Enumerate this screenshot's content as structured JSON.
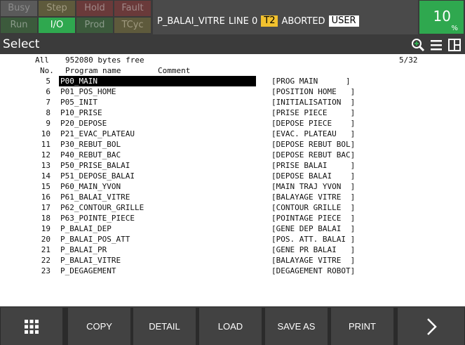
{
  "status_indicators": [
    {
      "label": "Busy"
    },
    {
      "label": "Step"
    },
    {
      "label": "Hold"
    },
    {
      "label": "Fault"
    },
    {
      "label": "Run"
    },
    {
      "label": "I/O"
    },
    {
      "label": "Prod"
    },
    {
      "label": "TCyc"
    }
  ],
  "title_bar": {
    "program": "P_BALAI_VITRE",
    "line": "LINE 0",
    "task_badge": "T2",
    "state": "ABORTED",
    "user_badge": "USER"
  },
  "override": {
    "value": "10",
    "unit": "%"
  },
  "header": {
    "title": "Select"
  },
  "icons": {
    "zoom": "zoom-in-icon",
    "menu": "hamburger-menu-icon",
    "split": "split-window-icon"
  },
  "list_info": {
    "filter": "All",
    "memory": "952080 bytes free",
    "page": "5/32",
    "col_no": "No.",
    "col_name": "Program name",
    "col_comment": "Comment"
  },
  "programs": [
    {
      "no": "5",
      "name": "P00_MAIN",
      "comment": "[PROG MAIN      ]",
      "selected": true
    },
    {
      "no": "6",
      "name": "P01_POS_HOME",
      "comment": "[POSITION HOME   ]"
    },
    {
      "no": "7",
      "name": "P05_INIT",
      "comment": "[INITIALISATION  ]"
    },
    {
      "no": "8",
      "name": "P10_PRISE",
      "comment": "[PRISE PIECE     ]"
    },
    {
      "no": "9",
      "name": "P20_DEPOSE",
      "comment": "[DEPOSE PIECE    ]"
    },
    {
      "no": "10",
      "name": "P21_EVAC_PLATEAU",
      "comment": "[EVAC. PLATEAU   ]"
    },
    {
      "no": "11",
      "name": "P30_REBUT_BOL",
      "comment": "[DEPOSE REBUT BOL]"
    },
    {
      "no": "12",
      "name": "P40_REBUT_BAC",
      "comment": "[DEPOSE REBUT BAC]"
    },
    {
      "no": "13",
      "name": "P50_PRISE_BALAI",
      "comment": "[PRISE BALAI     ]"
    },
    {
      "no": "14",
      "name": "P51_DEPOSE_BALAI",
      "comment": "[DEPOSE BALAI    ]"
    },
    {
      "no": "15",
      "name": "P60_MAIN_YVON",
      "comment": "[MAIN TRAJ YVON  ]"
    },
    {
      "no": "16",
      "name": "P61_BALAI_VITRE",
      "comment": "[BALAYAGE VITRE  ]"
    },
    {
      "no": "17",
      "name": "P62_CONTOUR_GRILLE",
      "comment": "[CONTOUR GRILLE  ]"
    },
    {
      "no": "18",
      "name": "P63_POINTE_PIECE",
      "comment": "[POINTAGE PIECE  ]"
    },
    {
      "no": "19",
      "name": "P_BALAI_DEP",
      "comment": "[GENE DEP BALAI  ]"
    },
    {
      "no": "20",
      "name": "P_BALAI_POS_ATT",
      "comment": "[POS. ATT. BALAI ]"
    },
    {
      "no": "21",
      "name": "P_BALAI_PR",
      "comment": "[GENE PR BALAI   ]"
    },
    {
      "no": "22",
      "name": "P_BALAI_VITRE",
      "comment": "[BALAYAGE VITRE  ]"
    },
    {
      "no": "23",
      "name": "P_DEGAGEMENT",
      "comment": "[DEGAGEMENT ROBOT]"
    }
  ],
  "softkeys": {
    "grid_icon": "grid-menu-icon",
    "copy": "COPY",
    "detail": "DETAIL",
    "load": "LOAD",
    "save_as": "SAVE AS",
    "print": "PRINT",
    "next_icon": "chevron-right-icon"
  }
}
